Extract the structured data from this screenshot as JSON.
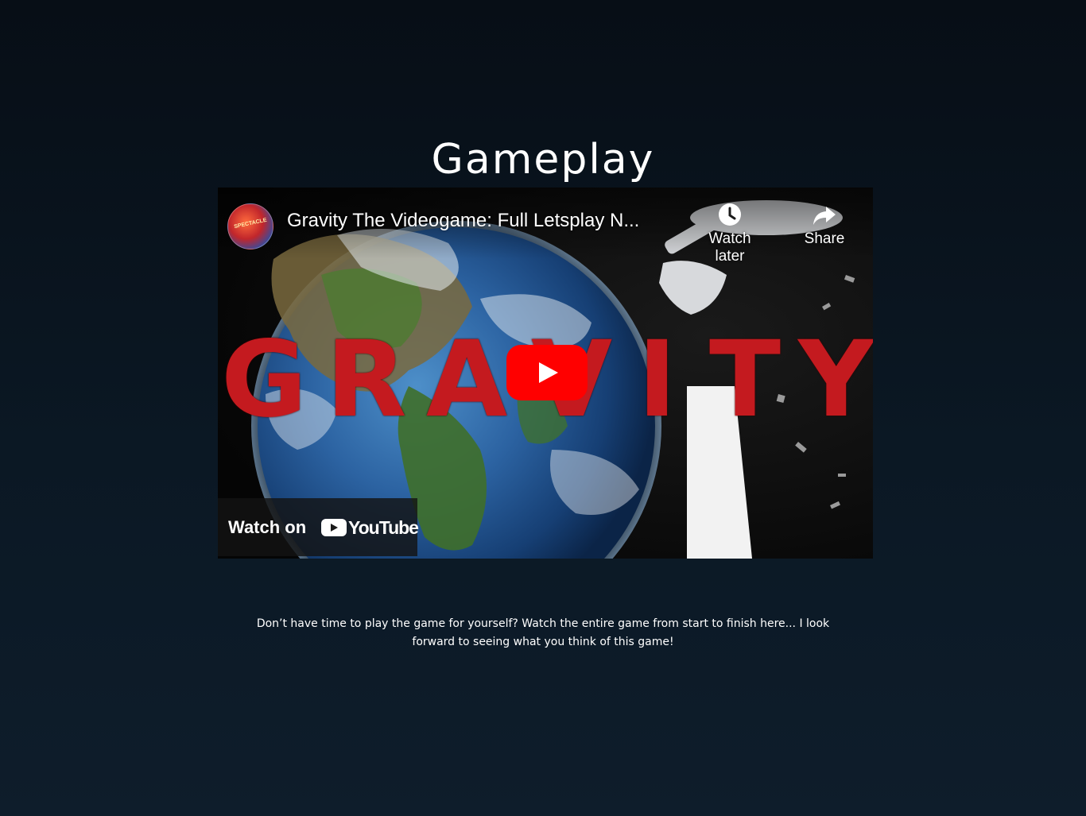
{
  "page": {
    "title": "Gameplay",
    "description": "Don’t have time to play the game for yourself? Watch the entire game from start to finish here... I look forward to seeing what you think of this game!"
  },
  "video": {
    "title": "Gravity The Videogame: Full Letsplay N...",
    "channel_avatar_text": "SPECTACLE",
    "watch_later_label": "Watch later",
    "share_label": "Share",
    "watch_on_label": "Watch on",
    "youtube_label": "YouTube",
    "thumbnail_word": [
      "G",
      "R",
      "A",
      "V",
      "I",
      "T",
      "Y"
    ],
    "icons": {
      "watch_later": "clock-icon",
      "share": "share-arrow-icon",
      "play": "play-icon",
      "youtube": "youtube-logo-icon"
    }
  },
  "colors": {
    "background": "#0b1824",
    "play_button": "#ff0000",
    "gravity_red": "#c41a1f"
  }
}
